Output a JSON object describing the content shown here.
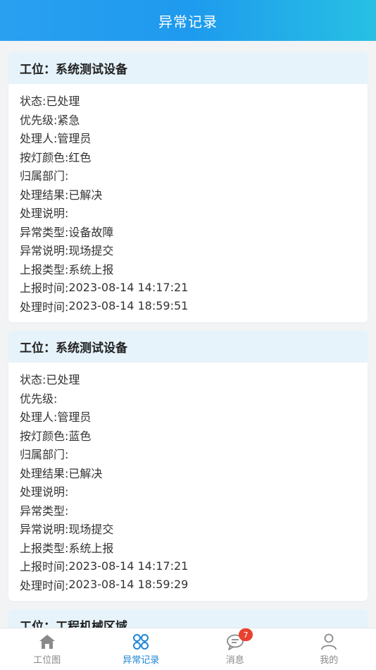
{
  "header": {
    "title": "异常记录"
  },
  "cards": [
    {
      "title": "工位：系统测试设备",
      "rows": [
        {
          "k": "状态:",
          "v": "已处理"
        },
        {
          "k": "优先级:",
          "v": "紧急"
        },
        {
          "k": "处理人:",
          "v": "管理员"
        },
        {
          "k": "按灯颜色:",
          "v": "红色"
        },
        {
          "k": "归属部门:",
          "v": ""
        },
        {
          "k": "处理结果:",
          "v": "已解决"
        },
        {
          "k": "处理说明:",
          "v": ""
        },
        {
          "k": "异常类型:",
          "v": "设备故障"
        },
        {
          "k": "异常说明:",
          "v": "现场提交"
        },
        {
          "k": "上报类型:",
          "v": "系统上报"
        },
        {
          "k": "上报时间:",
          "v": "2023-08-14 14:17:21"
        },
        {
          "k": "处理时间:",
          "v": "2023-08-14 18:59:51"
        }
      ]
    },
    {
      "title": "工位：系统测试设备",
      "rows": [
        {
          "k": "状态:",
          "v": "已处理"
        },
        {
          "k": "优先级:",
          "v": ""
        },
        {
          "k": "处理人:",
          "v": "管理员"
        },
        {
          "k": "按灯颜色:",
          "v": "蓝色"
        },
        {
          "k": "归属部门:",
          "v": ""
        },
        {
          "k": "处理结果:",
          "v": "已解决"
        },
        {
          "k": "处理说明:",
          "v": ""
        },
        {
          "k": "异常类型:",
          "v": ""
        },
        {
          "k": "异常说明:",
          "v": "现场提交"
        },
        {
          "k": "上报类型:",
          "v": "系统上报"
        },
        {
          "k": "上报时间:",
          "v": "2023-08-14 14:17:21"
        },
        {
          "k": "处理时间:",
          "v": "2023-08-14 18:59:29"
        }
      ]
    },
    {
      "title": "工位：工程机械区域",
      "rows": []
    }
  ],
  "tabbar": {
    "tabs": [
      {
        "label": "工位图",
        "icon": "home-icon"
      },
      {
        "label": "异常记录",
        "icon": "grid-circles-icon"
      },
      {
        "label": "消息",
        "icon": "chat-bubble-icon",
        "badge": "7"
      },
      {
        "label": "我的",
        "icon": "user-icon"
      }
    ],
    "active_color": "#1f86d6",
    "inactive_color": "#888888"
  }
}
